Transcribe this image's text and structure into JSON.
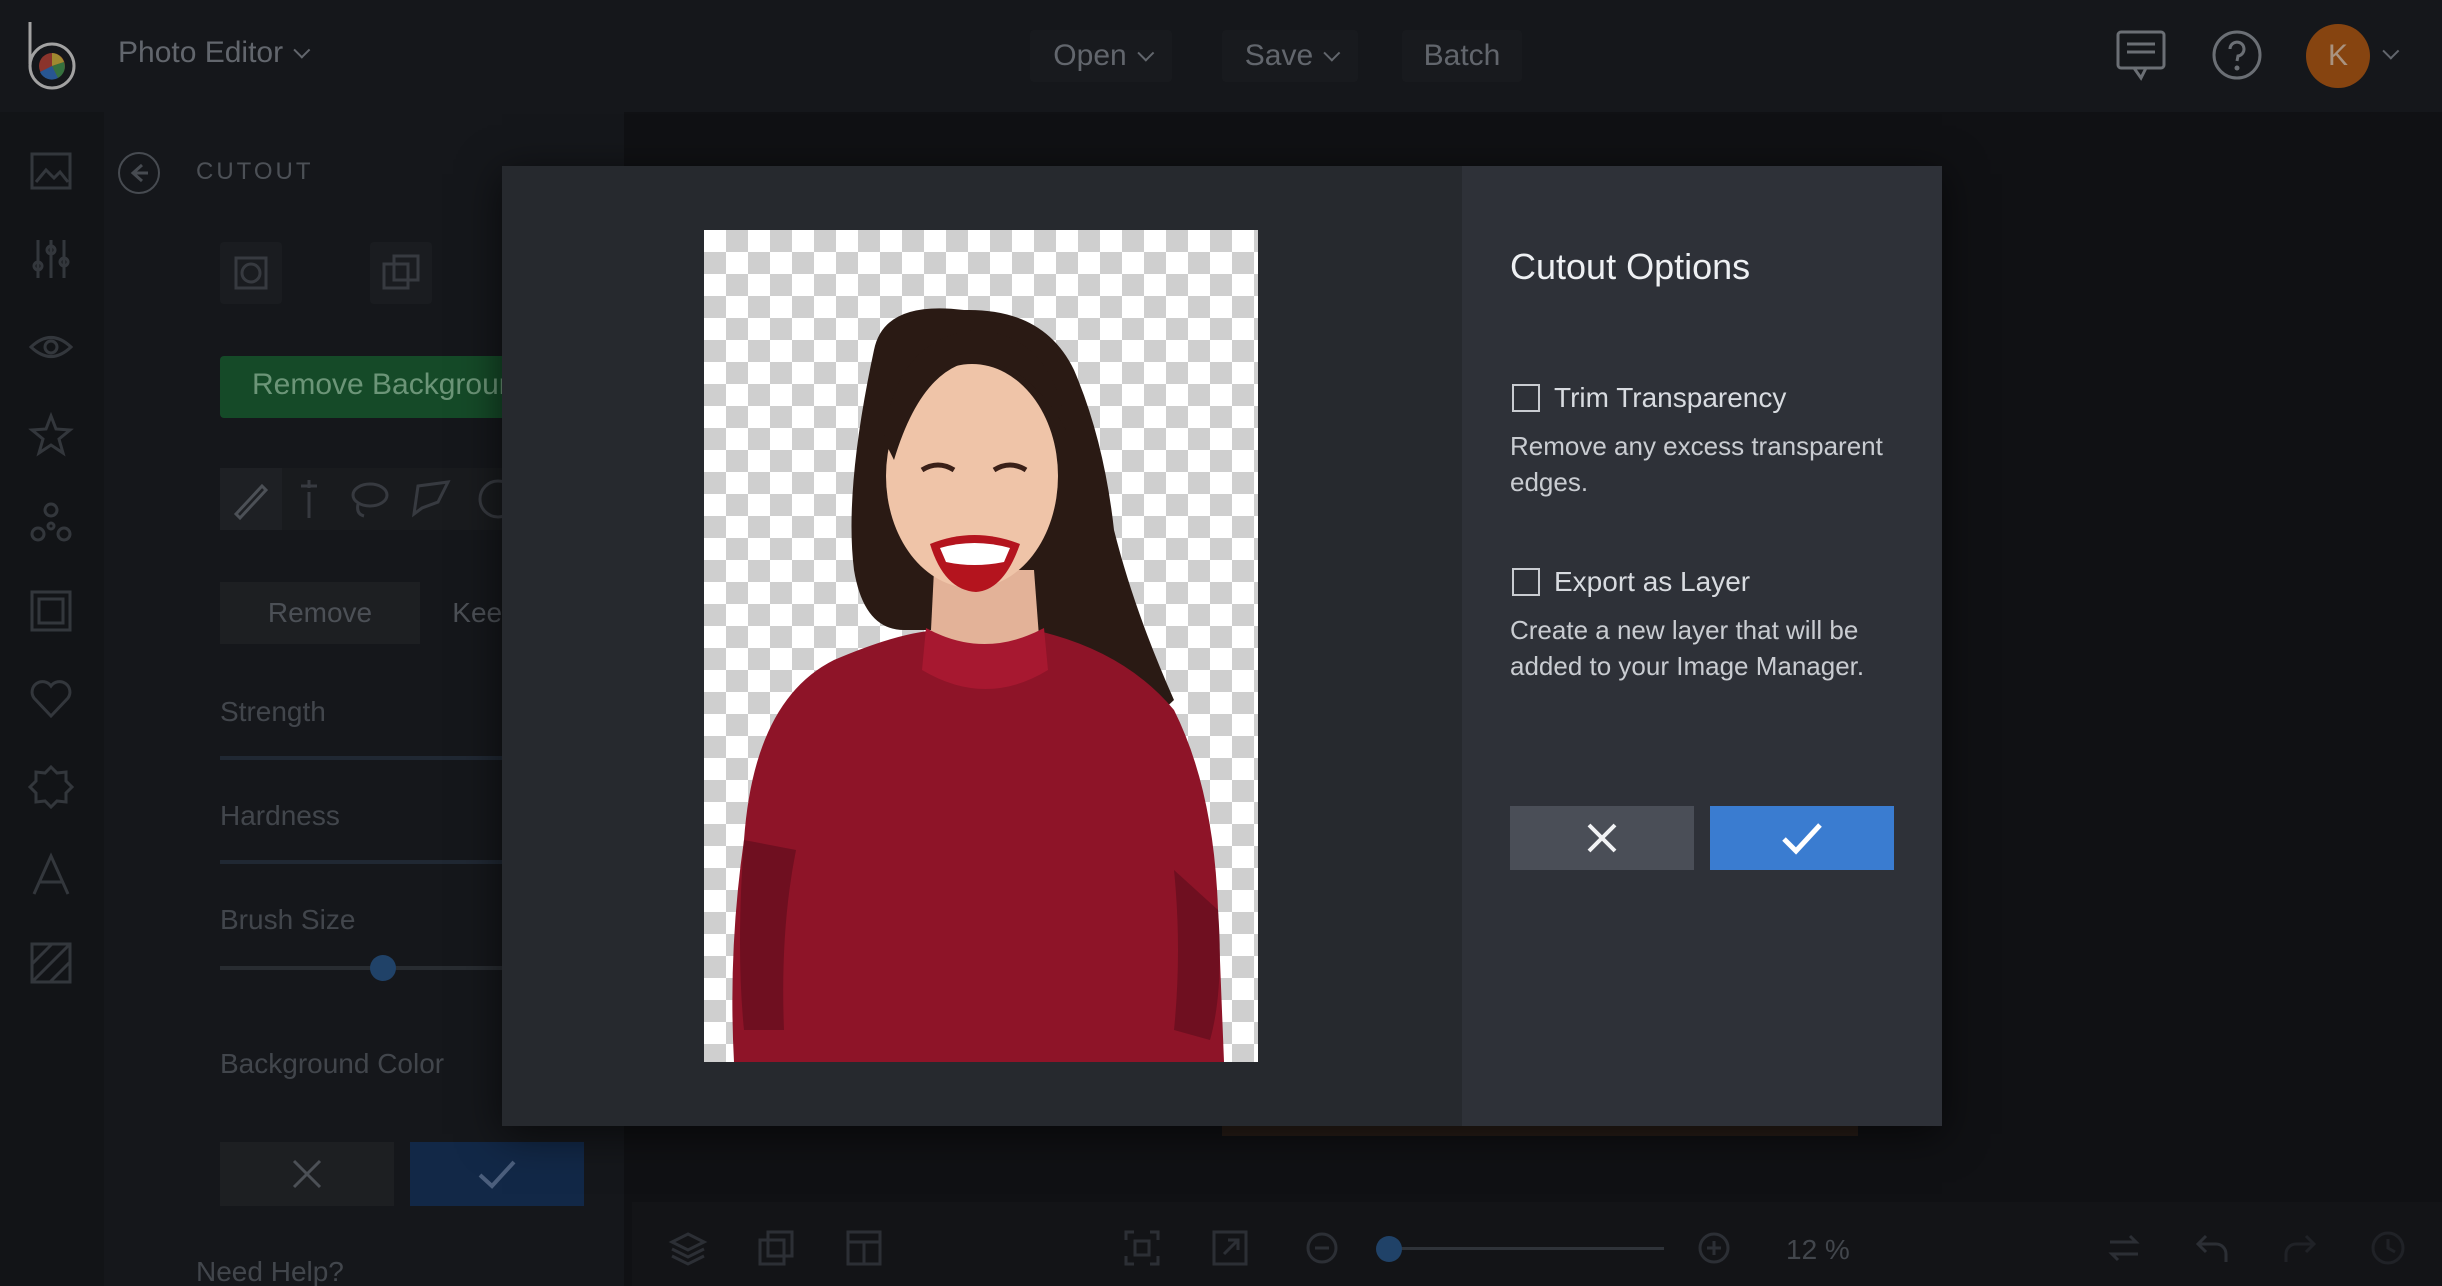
{
  "header": {
    "app_title": "Photo Editor",
    "menu": {
      "open": "Open",
      "save": "Save",
      "batch": "Batch"
    },
    "avatar_initial": "K"
  },
  "panel": {
    "title": "CUTOUT",
    "remove_background": "Remove Background",
    "mode_remove": "Remove",
    "mode_keep": "Keep",
    "strength_label": "Strength",
    "hardness_label": "Hardness",
    "brush_size_label": "Brush Size",
    "background_color_label": "Background Color",
    "need_help": "Need Help?"
  },
  "toolbar": {
    "zoom_value": "12 %"
  },
  "modal": {
    "title": "Cutout Options",
    "options": [
      {
        "label": "Trim Transparency",
        "description": "Remove any excess transparent edges.",
        "checked": false
      },
      {
        "label": "Export as Layer",
        "description": "Create a new layer that will be added to your Image Manager.",
        "checked": false
      }
    ]
  },
  "colors": {
    "accent": "#3a7cd0",
    "cancel": "#4a4e57",
    "remove_bg_green": "#1f6b3a",
    "avatar": "#c06218"
  }
}
